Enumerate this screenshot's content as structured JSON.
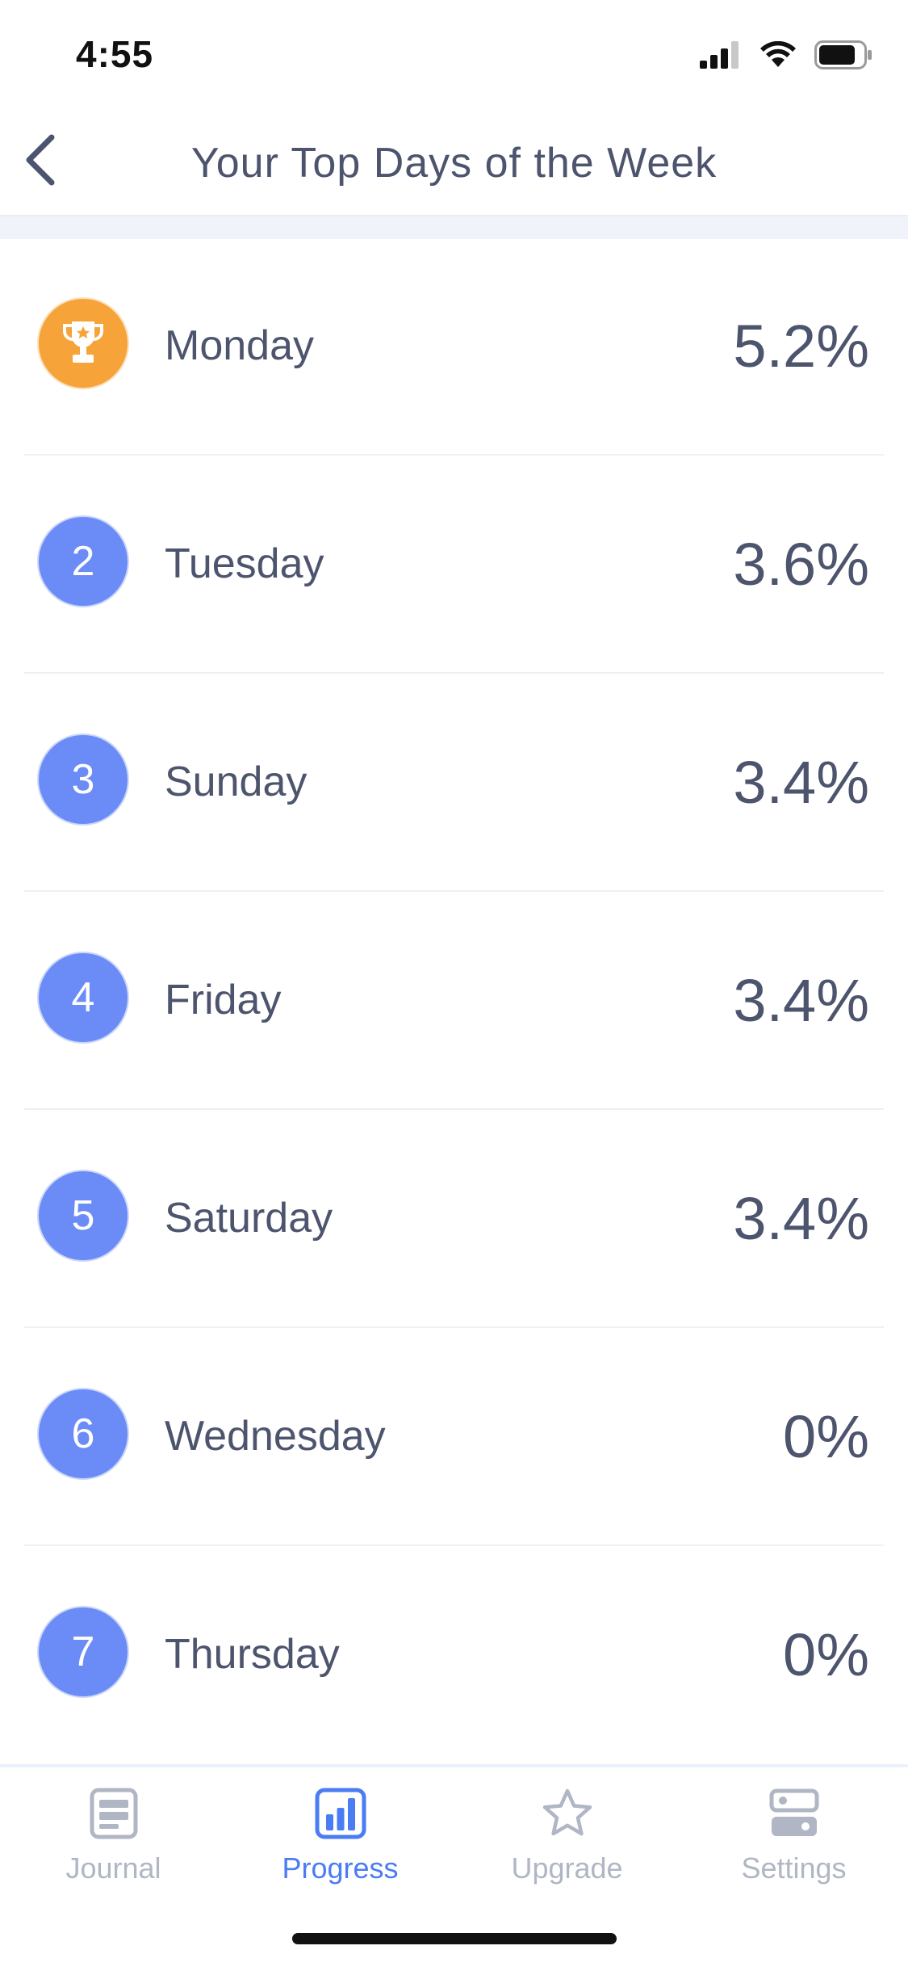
{
  "status_bar": {
    "time": "4:55"
  },
  "header": {
    "title": "Your Top Days of the Week"
  },
  "days": [
    {
      "rank": "1",
      "day": "Monday",
      "percent": "5.2%",
      "badge": "trophy-icon"
    },
    {
      "rank": "2",
      "day": "Tuesday",
      "percent": "3.6%"
    },
    {
      "rank": "3",
      "day": "Sunday",
      "percent": "3.4%"
    },
    {
      "rank": "4",
      "day": "Friday",
      "percent": "3.4%"
    },
    {
      "rank": "5",
      "day": "Saturday",
      "percent": "3.4%"
    },
    {
      "rank": "6",
      "day": "Wednesday",
      "percent": "0%"
    },
    {
      "rank": "7",
      "day": "Thursday",
      "percent": "0%"
    }
  ],
  "tabs": [
    {
      "label": "Journal",
      "icon": "journal-icon",
      "active": false
    },
    {
      "label": "Progress",
      "icon": "bar-chart-icon",
      "active": true
    },
    {
      "label": "Upgrade",
      "icon": "star-icon",
      "active": false
    },
    {
      "label": "Settings",
      "icon": "settings-icon",
      "active": false
    }
  ],
  "colors": {
    "accent": "#4a7cf4",
    "badge_blue": "#6b8cf6",
    "badge_gold": "#f6a33a",
    "text": "#4d546d",
    "inactive": "#b0b6c4"
  }
}
